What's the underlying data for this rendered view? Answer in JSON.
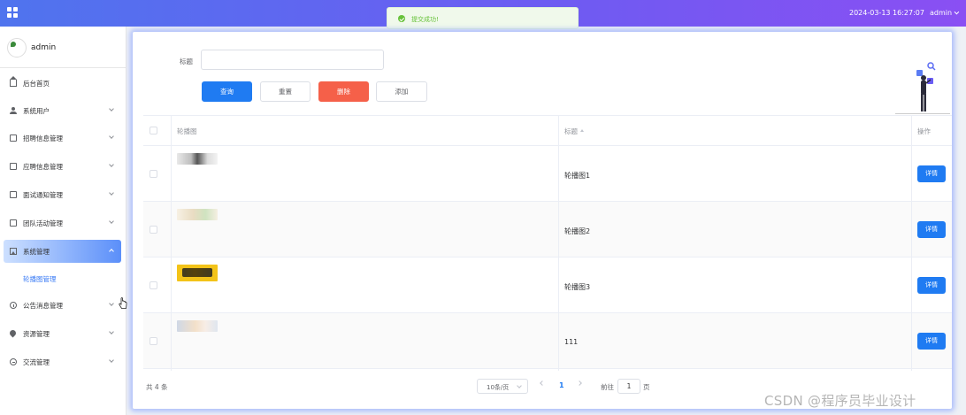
{
  "topbar": {
    "datetime": "2024-03-13 16:27:07",
    "user": "admin",
    "gradient_colors": [
      "#4f74ee",
      "#6c5cf2",
      "#8a4ff3"
    ]
  },
  "toast": {
    "message": "提交成功!",
    "type": "success",
    "color": "#67c23a"
  },
  "sidebar": {
    "username": "admin",
    "items": [
      {
        "label": "后台首页",
        "icon": "home-icon",
        "has_children": false
      },
      {
        "label": "系统用户",
        "icon": "user-icon",
        "has_children": true
      },
      {
        "label": "招聘信息管理",
        "icon": "document-icon",
        "has_children": true
      },
      {
        "label": "应聘信息管理",
        "icon": "document-icon",
        "has_children": true
      },
      {
        "label": "面试通知管理",
        "icon": "document-icon",
        "has_children": true
      },
      {
        "label": "团队活动管理",
        "icon": "document-icon",
        "has_children": true
      },
      {
        "label": "系统管理",
        "icon": "picture-icon",
        "has_children": true,
        "active": true
      },
      {
        "label": "公告消息管理",
        "icon": "info-icon",
        "has_children": true
      },
      {
        "label": "资源管理",
        "icon": "location-icon",
        "has_children": true
      },
      {
        "label": "交流管理",
        "icon": "chat-icon",
        "has_children": true
      }
    ],
    "submenu_active": "轮播图管理",
    "active_color": "#3a7bf5"
  },
  "search": {
    "label": "标题",
    "value": "",
    "placeholder": ""
  },
  "buttons": {
    "query": "查询",
    "reset": "重置",
    "delete": "删除",
    "add": "添加"
  },
  "table": {
    "columns": [
      "轮播图",
      "标题",
      "操作"
    ],
    "rows": [
      {
        "image": "carousel-image-1",
        "title": "轮播图1",
        "action": "详情"
      },
      {
        "image": "carousel-image-2",
        "title": "轮播图2",
        "action": "详情"
      },
      {
        "image": "carousel-image-3",
        "title": "轮播图3",
        "action": "详情"
      },
      {
        "image": "carousel-image-4",
        "title": "111",
        "action": "详情"
      }
    ]
  },
  "pagination": {
    "total_text": "共 4 条",
    "page_size": "10条/页",
    "current_page": "1",
    "goto_label": "前往",
    "goto_value": "1",
    "goto_unit": "页"
  },
  "watermark": "CSDN @程序员毕业设计",
  "colors": {
    "primary": "#1f7bf2",
    "danger": "#f56049"
  }
}
